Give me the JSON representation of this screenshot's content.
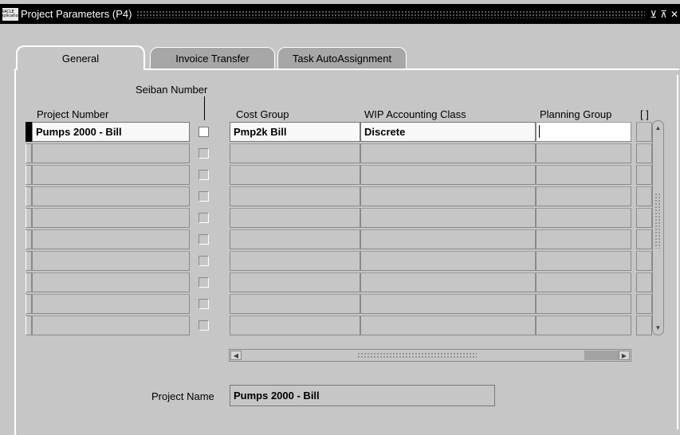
{
  "window": {
    "logo_text": "ORACLE Applications",
    "title": "Project Parameters (P4)",
    "buttons": [
      "⊻",
      "⊼",
      "✕"
    ]
  },
  "tabs": [
    {
      "label": "General",
      "active": true
    },
    {
      "label": "Invoice Transfer",
      "active": false
    },
    {
      "label": "Task AutoAssignment",
      "active": false
    }
  ],
  "columns": {
    "seiban": "Seiban Number",
    "project_number": "Project Number",
    "cost_group": "Cost Group",
    "wip_class": "WIP Accounting Class",
    "planning_group": "Planning Group",
    "flex": "[ ]"
  },
  "rows": [
    {
      "project_number": "Pumps 2000 - Bill",
      "seiban": false,
      "cost_group": "Pmp2k Bill",
      "wip_class": "Discrete",
      "planning_group": ""
    },
    {
      "project_number": "",
      "seiban": false,
      "cost_group": "",
      "wip_class": "",
      "planning_group": ""
    },
    {
      "project_number": "",
      "seiban": false,
      "cost_group": "",
      "wip_class": "",
      "planning_group": ""
    },
    {
      "project_number": "",
      "seiban": false,
      "cost_group": "",
      "wip_class": "",
      "planning_group": ""
    },
    {
      "project_number": "",
      "seiban": false,
      "cost_group": "",
      "wip_class": "",
      "planning_group": ""
    },
    {
      "project_number": "",
      "seiban": false,
      "cost_group": "",
      "wip_class": "",
      "planning_group": ""
    },
    {
      "project_number": "",
      "seiban": false,
      "cost_group": "",
      "wip_class": "",
      "planning_group": ""
    },
    {
      "project_number": "",
      "seiban": false,
      "cost_group": "",
      "wip_class": "",
      "planning_group": ""
    },
    {
      "project_number": "",
      "seiban": false,
      "cost_group": "",
      "wip_class": "",
      "planning_group": ""
    },
    {
      "project_number": "",
      "seiban": false,
      "cost_group": "",
      "wip_class": "",
      "planning_group": ""
    }
  ],
  "footer": {
    "project_name_label": "Project Name",
    "project_name_value": "Pumps 2000 - Bill"
  },
  "icons": {
    "scroll_up": "up-arrow-icon",
    "scroll_down": "down-arrow-icon",
    "scroll_left": "left-arrow-icon",
    "scroll_right": "right-arrow-icon"
  }
}
